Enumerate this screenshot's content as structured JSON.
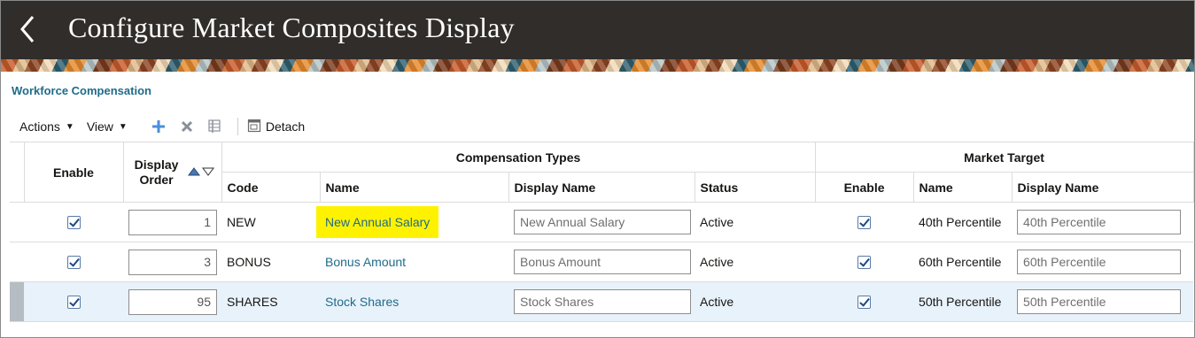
{
  "header": {
    "title": "Configure Market Composites Display"
  },
  "section": {
    "title": "Workforce Compensation"
  },
  "toolbar": {
    "actions_label": "Actions",
    "view_label": "View",
    "detach_label": "Detach"
  },
  "table": {
    "headers": {
      "enable": "Enable",
      "display_order": "Display Order",
      "comp_types_group": "Compensation Types",
      "market_target_group": "Market Target",
      "code": "Code",
      "name": "Name",
      "display_name": "Display Name",
      "status": "Status",
      "mt_enable": "Enable",
      "mt_name": "Name",
      "mt_display_name": "Display Name"
    },
    "rows": [
      {
        "enabled": true,
        "order": "1",
        "code": "NEW",
        "name": "New Annual Salary",
        "display_name": "New Annual Salary",
        "status": "Active",
        "mt_enabled": true,
        "mt_name": "40th Percentile",
        "mt_display_name": "40th Percentile",
        "highlighted": true,
        "selected": false
      },
      {
        "enabled": true,
        "order": "3",
        "code": "BONUS",
        "name": "Bonus Amount",
        "display_name": "Bonus Amount",
        "status": "Active",
        "mt_enabled": true,
        "mt_name": "60th Percentile",
        "mt_display_name": "60th Percentile",
        "highlighted": false,
        "selected": false
      },
      {
        "enabled": true,
        "order": "95",
        "code": "SHARES",
        "name": "Stock Shares",
        "display_name": "Stock Shares",
        "status": "Active",
        "mt_enabled": true,
        "mt_name": "50th Percentile",
        "mt_display_name": "50th Percentile",
        "highlighted": false,
        "selected": true
      }
    ]
  },
  "colors": {
    "header_bg": "#312d2a",
    "link": "#1f6b8a",
    "highlight": "#fff200",
    "selected_row": "#e8f2fb"
  },
  "icons": [
    "back-chevron-icon",
    "add-icon",
    "delete-icon",
    "freeze-icon",
    "detach-icon",
    "sort-ascending-icon",
    "sort-descending-icon",
    "checkbox-checked-icon"
  ]
}
